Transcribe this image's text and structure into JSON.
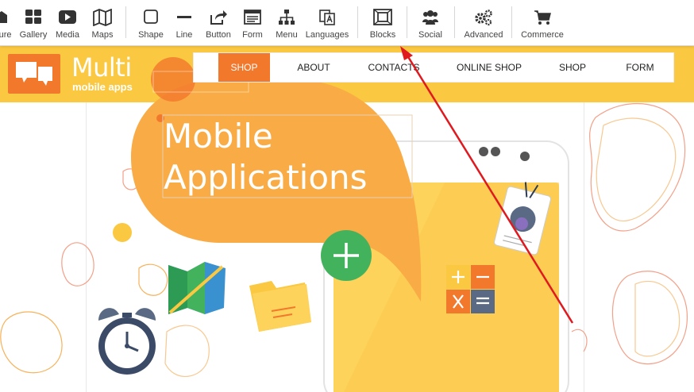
{
  "toolbar": {
    "items": [
      {
        "label": "ture",
        "icon": "picture-icon"
      },
      {
        "label": "Gallery",
        "icon": "gallery-icon"
      },
      {
        "label": "Media",
        "icon": "media-icon"
      },
      {
        "label": "Maps",
        "icon": "map-icon"
      },
      {
        "label": "Shape",
        "icon": "shape-icon"
      },
      {
        "label": "Line",
        "icon": "line-icon"
      },
      {
        "label": "Button",
        "icon": "button-icon"
      },
      {
        "label": "Form",
        "icon": "form-icon"
      },
      {
        "label": "Menu",
        "icon": "menu-icon"
      },
      {
        "label": "Languages",
        "icon": "languages-icon"
      },
      {
        "label": "Blocks",
        "icon": "blocks-icon"
      },
      {
        "label": "Social",
        "icon": "social-icon"
      },
      {
        "label": "Advanced",
        "icon": "advanced-icon"
      },
      {
        "label": "Commerce",
        "icon": "commerce-icon"
      }
    ]
  },
  "site": {
    "logo_title": "Multi",
    "logo_subtitle": "mobile apps",
    "nav": [
      "SHOP",
      "ABOUT",
      "CONTACTS",
      "ONLINE SHOP",
      "SHOP",
      "FORM"
    ],
    "active_nav": "SHOP",
    "hero_line1": "Mobile",
    "hero_line2": "Applications"
  },
  "colors": {
    "header": "#fbc841",
    "accent_orange": "#f2782c",
    "bubble": "#f9ab45",
    "phone_screen": "#fdd35b",
    "plus_button": "#43b25d",
    "arrow": "#e0191f"
  }
}
